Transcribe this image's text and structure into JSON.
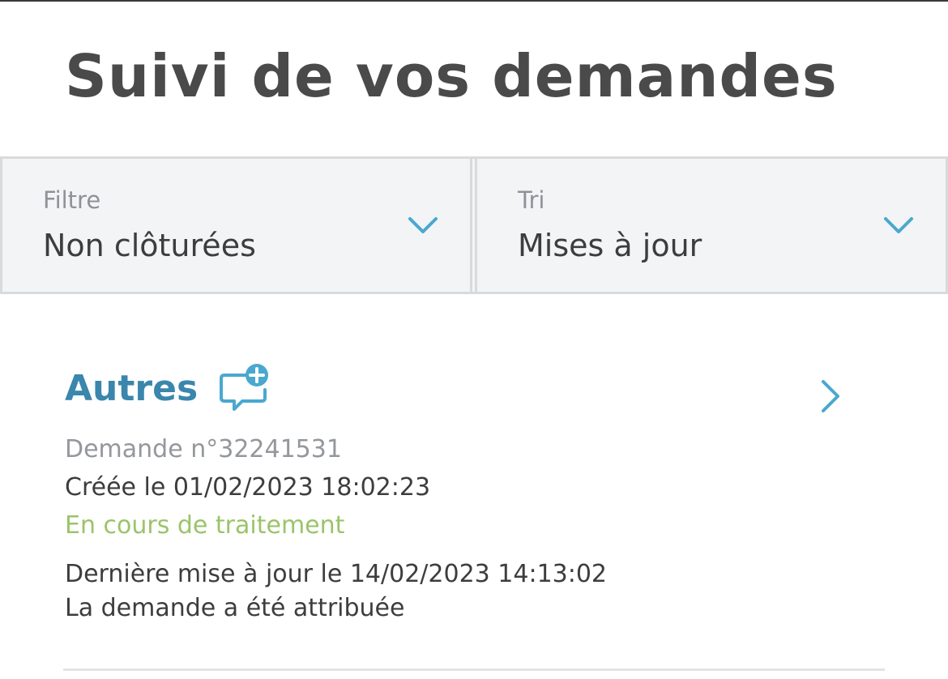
{
  "page": {
    "title": "Suivi de vos demandes"
  },
  "filters": {
    "filter": {
      "label": "Filtre",
      "value": "Non clôturées"
    },
    "sort": {
      "label": "Tri",
      "value": "Mises à jour"
    }
  },
  "request": {
    "category": "Autres",
    "number": "Demande n°32241531",
    "created": "Créée le 01/02/2023 18:02:23",
    "status": "En cours de traitement",
    "last_update": "Dernière mise à jour le 14/02/2023 14:13:02",
    "update_message": "La demande a été attribuée"
  },
  "colors": {
    "accent": "#3a86ad",
    "icon": "#4aa8cf",
    "status": "#9bc46a",
    "text": "#3d3d3d",
    "muted": "#94979b"
  },
  "icons": {
    "filter_chevron": "chevron-down-icon",
    "sort_chevron": "chevron-down-icon",
    "card_chevron": "chevron-right-icon",
    "category": "chat-plus-icon"
  }
}
